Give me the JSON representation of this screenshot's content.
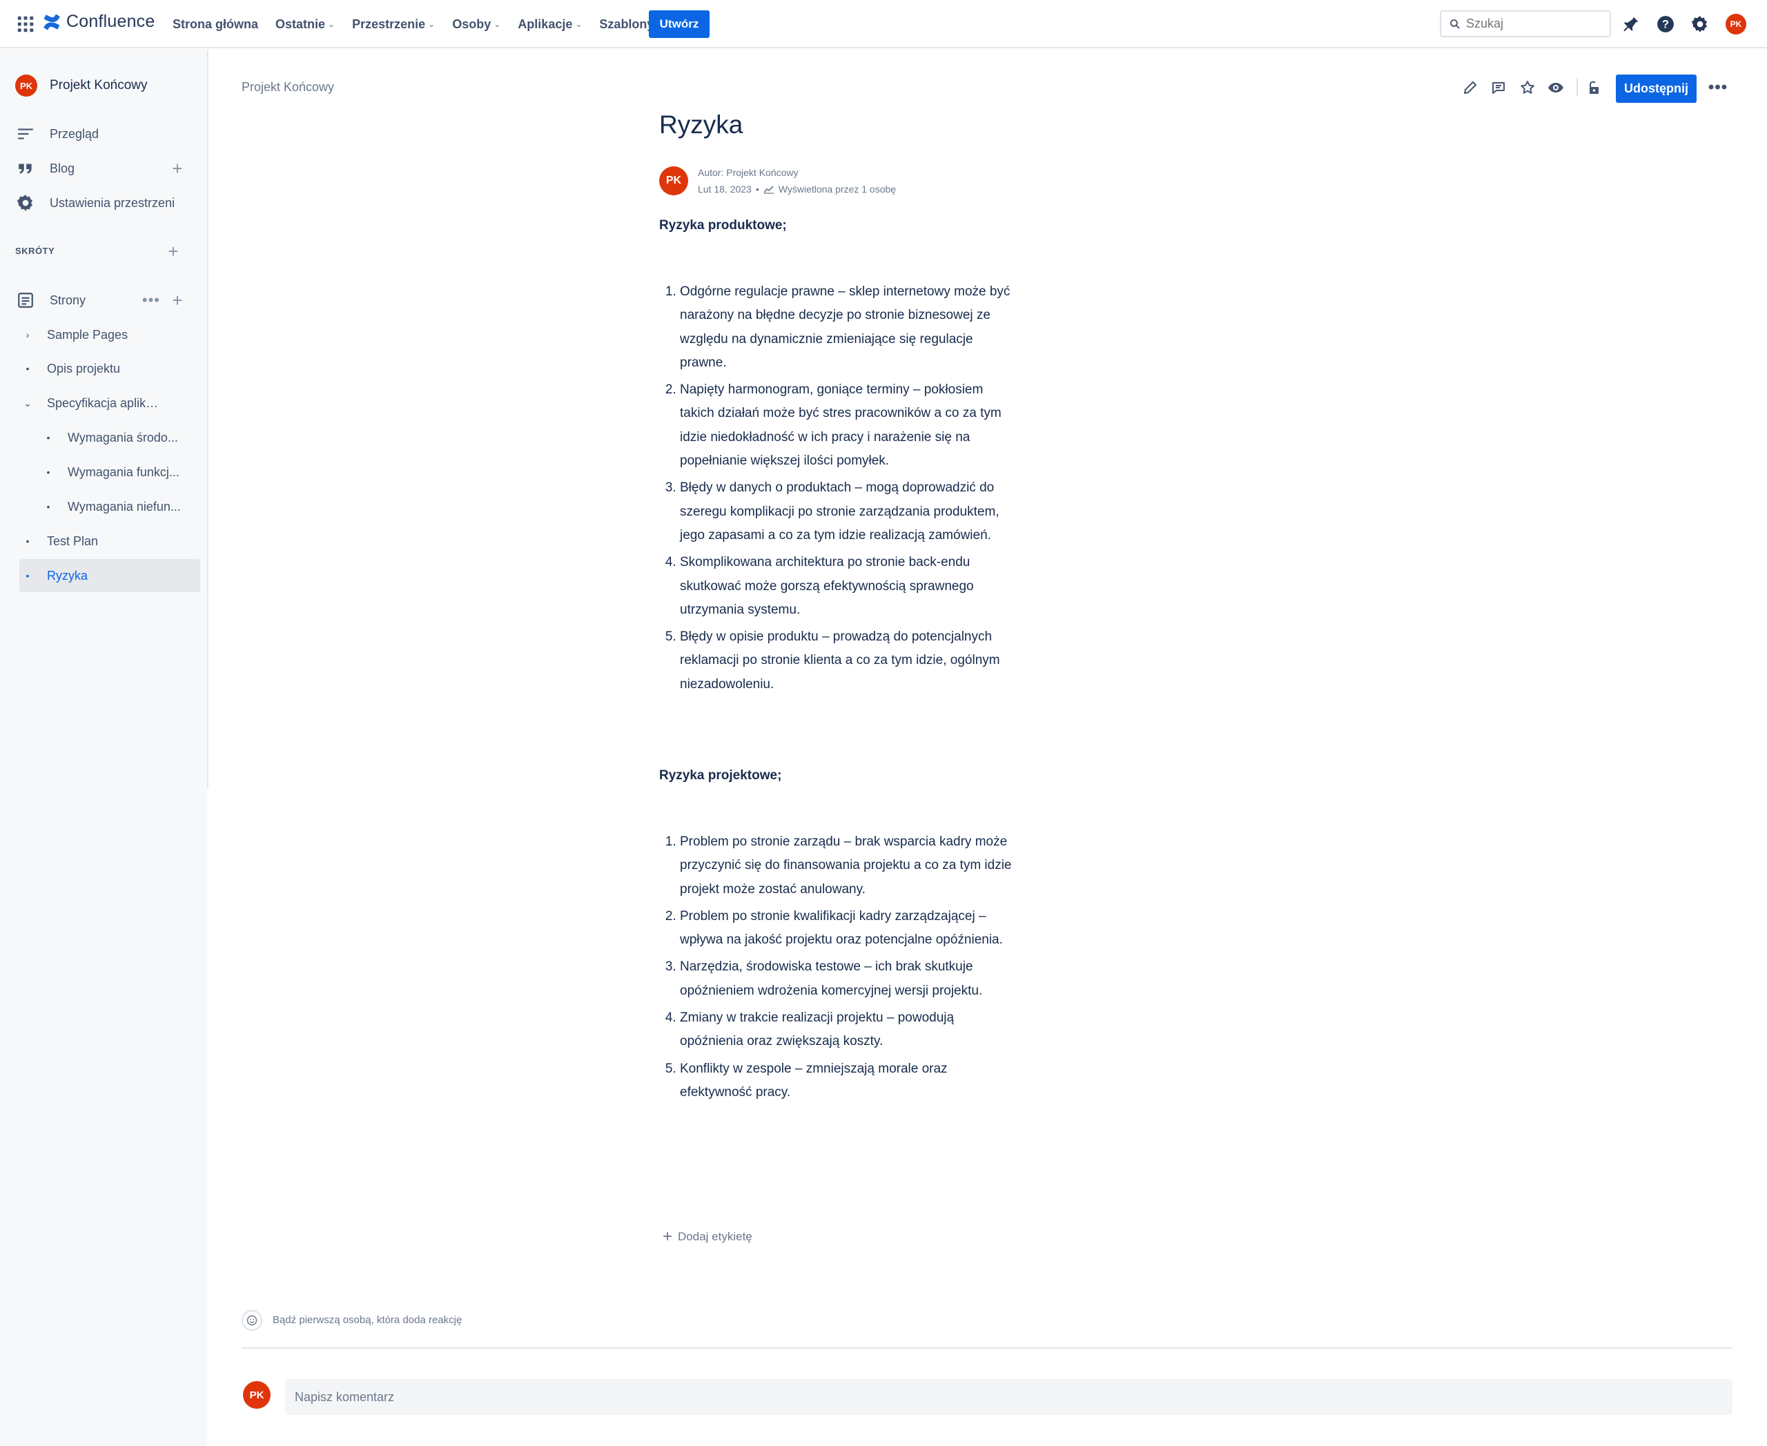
{
  "topnav": {
    "app_name": "Confluence",
    "items": [
      {
        "label": "Strona główna",
        "dropdown": false
      },
      {
        "label": "Ostatnie",
        "dropdown": true
      },
      {
        "label": "Przestrzenie",
        "dropdown": true
      },
      {
        "label": "Osoby",
        "dropdown": true
      },
      {
        "label": "Aplikacje",
        "dropdown": true
      },
      {
        "label": "Szablony",
        "dropdown": false
      }
    ],
    "create_label": "Utwórz",
    "search_placeholder": "Szukaj",
    "user_initials": "PK",
    "colors": {
      "accent": "#0c66e4",
      "avatar": "#de350b"
    }
  },
  "sidebar": {
    "space_initials": "PK",
    "space_name": "Projekt Końcowy",
    "nav": {
      "overview": "Przegląd",
      "blog": "Blog",
      "settings": "Ustawienia przestrzeni"
    },
    "shortcuts_label": "SKRÓTY",
    "pages_label": "Strony",
    "tree": [
      {
        "label": "Sample Pages",
        "marker": "›"
      },
      {
        "label": "Opis projektu",
        "marker": "•"
      },
      {
        "label": "Specyfikacja aplikacji",
        "marker": "⌄"
      },
      {
        "label": "Wymagania środo...",
        "marker": "•"
      },
      {
        "label": "Wymagania funkcj...",
        "marker": "•"
      },
      {
        "label": "Wymagania niefun...",
        "marker": "•"
      },
      {
        "label": "Test Plan",
        "marker": "•"
      },
      {
        "label": "Ryzyka",
        "marker": "•"
      }
    ]
  },
  "page": {
    "breadcrumb": "Projekt Końcowy",
    "share_label": "Udostępnij",
    "title": "Ryzyka",
    "author_initials": "PK",
    "author_line": "Autor: Projekt Końcowy",
    "date": "Lut 18, 2023",
    "views": "Wyświetlona przez 1 osobę",
    "product_heading": "Ryzyka produktowe;",
    "product_risks": [
      "Odgórne regulacje prawne – sklep internetowy może być narażony na błędne decyzje po stronie biznesowej ze względu na dynamicznie zmieniające się regulacje prawne.",
      "Napięty harmonogram, goniące terminy – pokłosiem takich działań może być stres pracowników a co za tym idzie niedokładność w ich pracy i narażenie się na popełnianie większej ilości pomyłek.",
      "Błędy w danych o produktach – mogą doprowadzić do szeregu komplikacji po stronie zarządzania produktem, jego zapasami a co za tym idzie realizacją zamówień.",
      "Skomplikowana architektura po stronie back-endu skutkować może gorszą efektywnością sprawnego utrzymania systemu.",
      "Błędy w opisie produktu – prowadzą do potencjalnych reklamacji po stronie klienta a co za tym idzie, ogólnym niezadowoleniu."
    ],
    "project_heading": "Ryzyka projektowe;",
    "project_risks": [
      "Problem po stronie zarządu – brak wsparcia kadry może przyczynić się do finansowania projektu a co za tym idzie projekt może zostać anulowany.",
      "Problem po stronie kwalifikacji kadry zarządzającej – wpływa na jakość projektu oraz potencjalne opóźnienia.",
      "Narzędzia, środowiska testowe – ich brak skutkuje opóźnieniem wdrożenia komercyjnej wersji projektu.",
      "Zmiany w trakcie realizacji projektu – powodują opóźnienia oraz zwiększają koszty.",
      "Konflikty w zespole – zmniejszają morale oraz efektywność pracy."
    ],
    "add_label": "Dodaj etykietę",
    "reaction_prompt": "Bądź pierwszą osobą, która doda reakcję",
    "comment_placeholder": "Napisz komentarz",
    "commenter_initials": "PK"
  }
}
